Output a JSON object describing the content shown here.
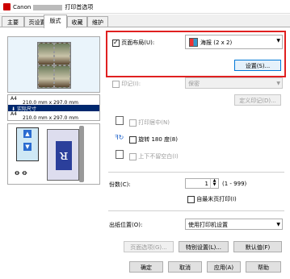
{
  "window": {
    "brand": "Canon",
    "title_suffix": "打印首选项"
  },
  "tabs": [
    {
      "label": "主要"
    },
    {
      "label": "页设置"
    },
    {
      "label": "版式"
    },
    {
      "label": "收藏"
    },
    {
      "label": "维护"
    }
  ],
  "preview": {
    "paper_size": "A4",
    "paper_dims_top": "210.0 mm x 297.0 mm",
    "scaling": "实际尺寸",
    "paper_size_bottom": "A4",
    "paper_dims_bottom": "210.0 mm x 297.0 mm"
  },
  "layout": {
    "page_layout_label": "页面布局(U):",
    "page_layout_checked": true,
    "page_layout_value": "海报 (2 x 2)",
    "settings_button": "设置(S)...",
    "stamp_label": "印记(I):",
    "stamp_value": "保密",
    "define_stamp_button": "定义印记(D)...",
    "print_center_label": "打印居中(N)",
    "rotate_label": "旋转 180 度(8)",
    "flip_label": "上下不留空白(I)"
  },
  "copies": {
    "label": "份数(C):",
    "value": "1",
    "range": "(1 - 999)",
    "reverse_label": "自最末页打印(I)"
  },
  "output": {
    "label": "出纸位置(O):",
    "value": "使用打印机设置"
  },
  "bottom_buttons": {
    "page_options": "页面选项(G)...",
    "special_settings": "特别设置(L)...",
    "defaults": "默认值(F)"
  },
  "dialog_buttons": {
    "ok": "确定",
    "cancel": "取消",
    "apply": "应用(A)",
    "help": "帮助"
  }
}
